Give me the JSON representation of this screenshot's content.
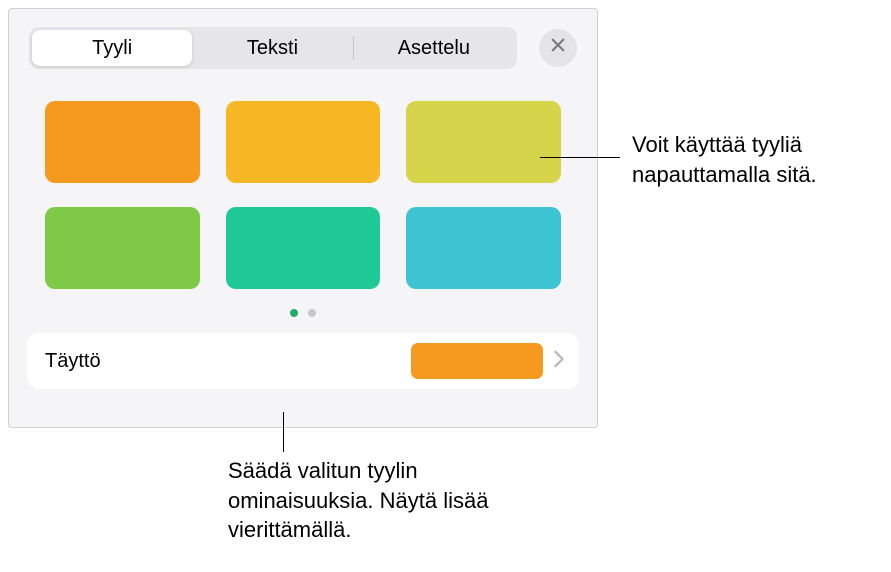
{
  "tabs": {
    "style": "Tyyli",
    "text": "Teksti",
    "layout": "Asettelu"
  },
  "swatches": [
    {
      "id": "orange",
      "color": "#F59A1E"
    },
    {
      "id": "amber",
      "color": "#F6B725"
    },
    {
      "id": "olive",
      "color": "#D6D44B"
    },
    {
      "id": "green",
      "color": "#7EC945"
    },
    {
      "id": "teal",
      "color": "#1EC997"
    },
    {
      "id": "cyan",
      "color": "#3CC4D3"
    }
  ],
  "pagination": {
    "current": 0,
    "total": 2
  },
  "fill": {
    "label": "Täyttö",
    "preview_color": "#F59A1E"
  },
  "callouts": {
    "tap_style": "Voit käyttää tyyliä napauttamalla sitä.",
    "adjust_props": "Säädä valitun tyylin ominaisuuksia. Näytä lisää vierittämällä."
  }
}
